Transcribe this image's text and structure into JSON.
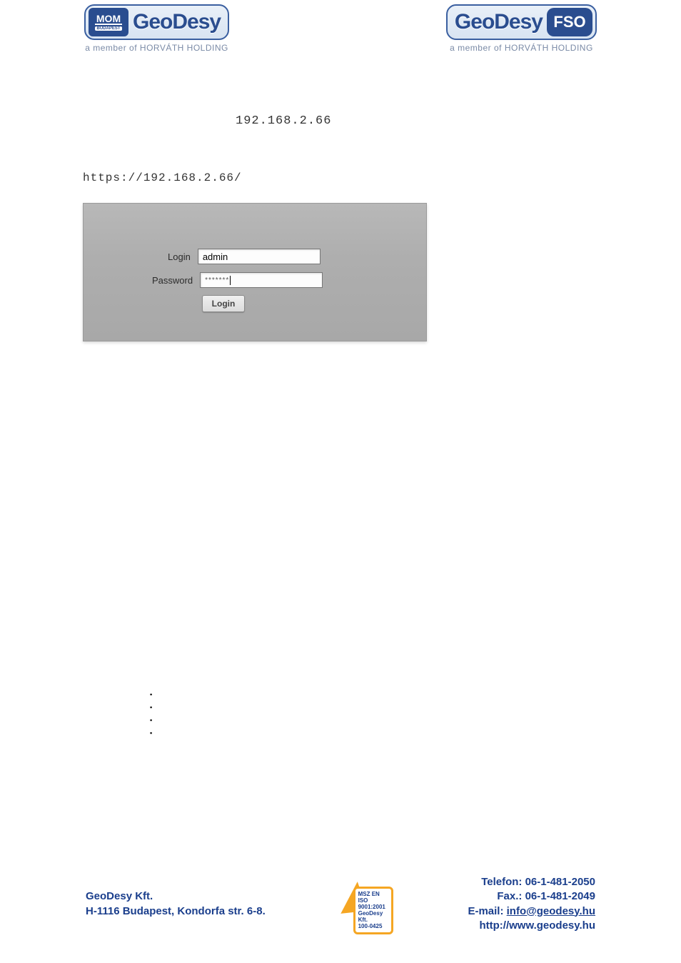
{
  "header": {
    "brand": "GeoDesy",
    "tagline": "a member of HORVÁTH HOLDING",
    "mom_top": "MOM",
    "mom_bot": "BUDAPEST",
    "fso": "FSO"
  },
  "ip_title": "192.168.2.66",
  "url": "https://192.168.2.66/",
  "login_form": {
    "login_label": "Login",
    "login_value": "admin",
    "password_label": "Password",
    "password_mask": "*******",
    "button": "Login"
  },
  "iso": {
    "l1": "MSZ EN",
    "l2": "ISO 9001:2001",
    "l3": "GeoDesy Kft.",
    "l4": "100-0425"
  },
  "footer": {
    "company": "GeoDesy Kft.",
    "address": "H-1116 Budapest, Kondorfa str. 6-8.",
    "phone": "Telefon: 06-1-481-2050",
    "fax": "Fax.: 06-1-481-2049",
    "email_prefix": "E-mail: ",
    "email": "info@geodesy.hu",
    "web": "http://www.geodesy.hu"
  }
}
